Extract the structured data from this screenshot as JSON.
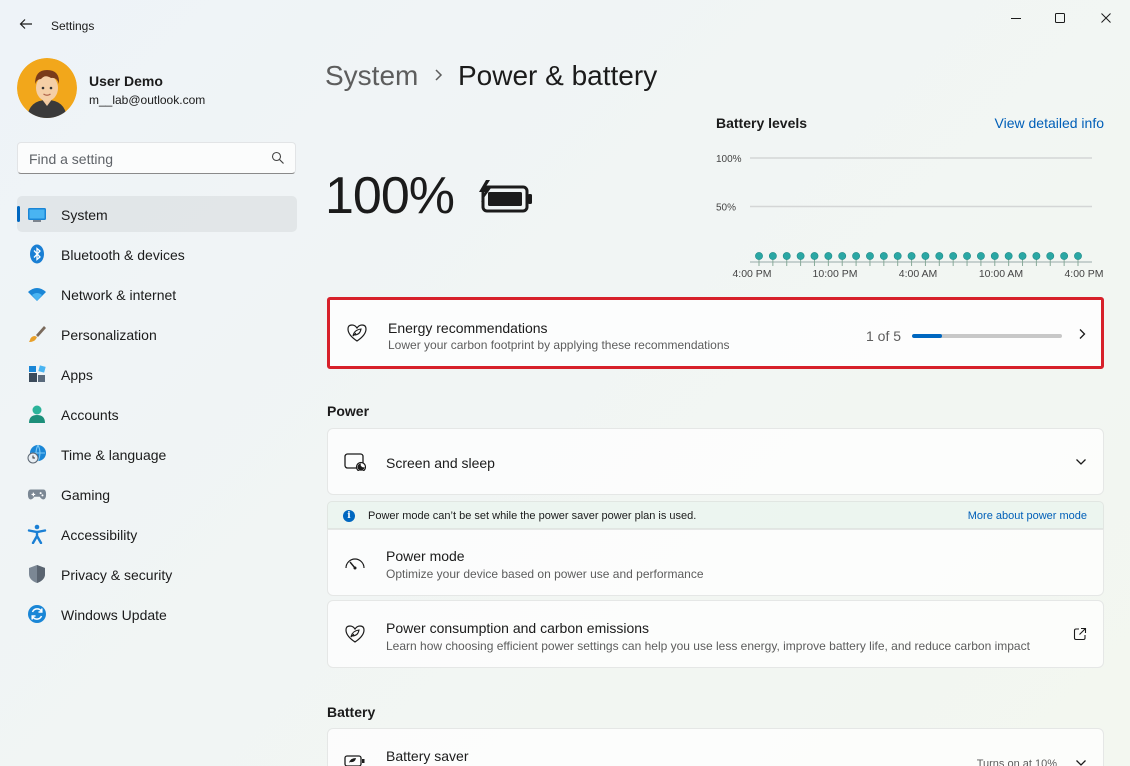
{
  "window": {
    "title": "Settings",
    "back_icon": "back-arrow-icon",
    "controls": [
      "minimize-icon",
      "maximize-icon",
      "close-icon"
    ]
  },
  "profile": {
    "name": "User Demo",
    "email": "m__lab@outlook.com"
  },
  "search": {
    "placeholder": "Find a setting"
  },
  "sidebar": {
    "items": [
      {
        "label": "System",
        "icon": "monitor-icon",
        "active": true
      },
      {
        "label": "Bluetooth & devices",
        "icon": "bluetooth-icon"
      },
      {
        "label": "Network & internet",
        "icon": "wifi-icon"
      },
      {
        "label": "Personalization",
        "icon": "paintbrush-icon"
      },
      {
        "label": "Apps",
        "icon": "apps-icon"
      },
      {
        "label": "Accounts",
        "icon": "person-icon"
      },
      {
        "label": "Time & language",
        "icon": "globe-clock-icon"
      },
      {
        "label": "Gaming",
        "icon": "gamepad-icon"
      },
      {
        "label": "Accessibility",
        "icon": "accessibility-icon"
      },
      {
        "label": "Privacy & security",
        "icon": "shield-icon"
      },
      {
        "label": "Windows Update",
        "icon": "update-icon"
      }
    ]
  },
  "header": {
    "root": "System",
    "current": "Power & battery"
  },
  "battery": {
    "percentage": "100%",
    "icon": "battery-charging-icon"
  },
  "chart": {
    "title": "Battery levels",
    "link": "View detailed info"
  },
  "chart_data": {
    "type": "scatter",
    "title": "Battery levels",
    "y_ticks": [
      "100%",
      "50%"
    ],
    "x_ticks": [
      "4:00 PM",
      "10:00 PM",
      "4:00 AM",
      "10:00 AM",
      "4:00 PM"
    ],
    "ylim": [
      0,
      100
    ],
    "points_count": 24,
    "point_color": "#2aa7a4",
    "grid": true
  },
  "energy": {
    "title": "Energy recommendations",
    "subtitle": "Lower your carbon footprint by applying these recommendations",
    "progress_text": "1 of 5",
    "progress_fraction": 0.2,
    "icon": "leaf-heart-icon"
  },
  "power_section": {
    "label": "Power",
    "screen_sleep": {
      "title": "Screen and sleep",
      "icon": "screen-sleep-icon"
    },
    "info": {
      "text": "Power mode can’t be set while the power saver power plan is used.",
      "link": "More about power mode"
    },
    "power_mode": {
      "title": "Power mode",
      "subtitle": "Optimize your device based on power use and performance",
      "icon": "gauge-icon"
    },
    "consumption": {
      "title": "Power consumption and carbon emissions",
      "subtitle": "Learn how choosing efficient power settings can help you use less energy, improve battery life, and reduce carbon impact",
      "icon": "leaf-heart-icon"
    }
  },
  "battery_section": {
    "label": "Battery",
    "saver": {
      "title": "Battery saver",
      "status": "Turns on at 10%",
      "icon": "battery-saver-icon"
    }
  },
  "colors": {
    "accent": "#0067c0",
    "link": "#005fb8",
    "highlight_border": "#d7202a",
    "chart_points": "#2aa7a4"
  }
}
